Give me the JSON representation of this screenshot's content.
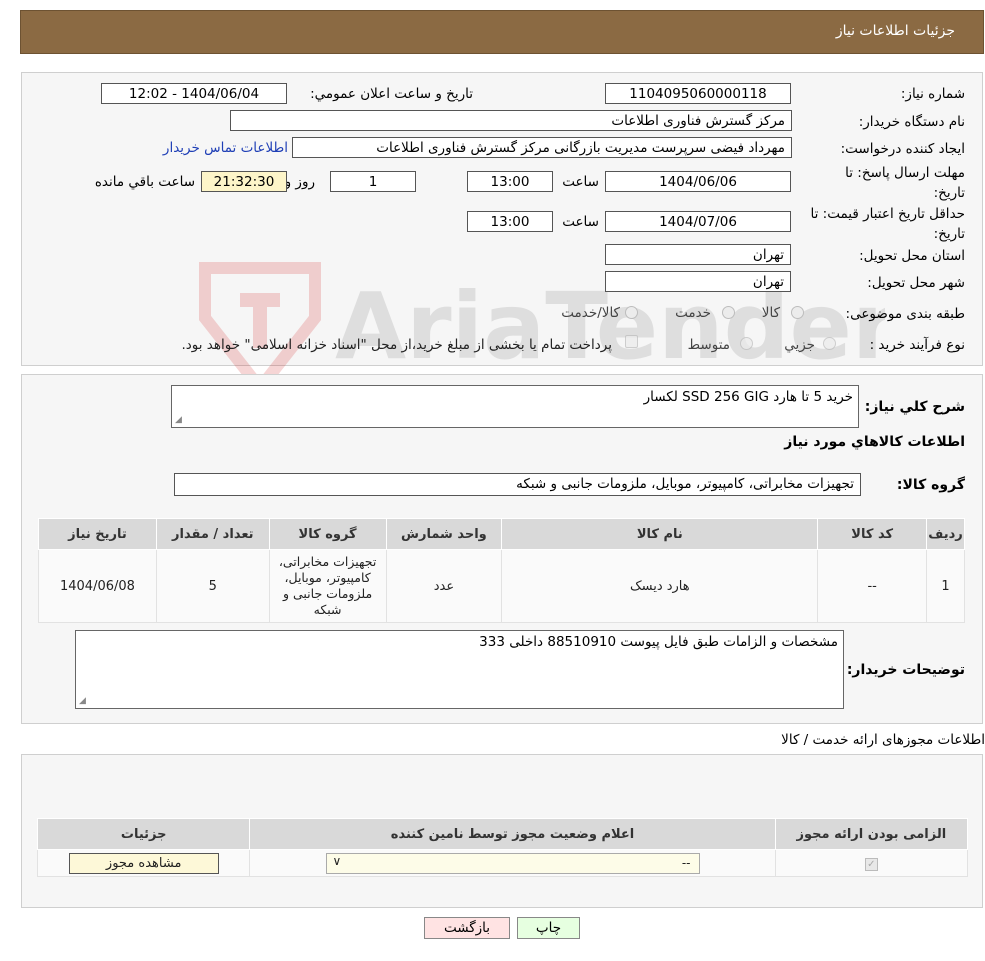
{
  "header": {
    "title": "جزئیات اطلاعات نیاز"
  },
  "watermark": {
    "text": "AriaTender.neT"
  },
  "fields": {
    "need_number_label": "شماره نیاز:",
    "need_number": "1104095060000118",
    "announce_label": "تاریخ و ساعت اعلان عمومي:",
    "announce_value": "1404/06/04 - 12:02",
    "buyer_org_label": "نام دستگاه خريدار:",
    "buyer_org": "مرکز گسترش فناوری اطلاعات",
    "creator_label": "ايجاد کننده درخواست:",
    "creator": "مهرداد فیضی سرپرست مدیریت بازرگانی مرکز گسترش فناوری اطلاعات",
    "contact_link": "اطلاعات تماس خريدار",
    "deadline_label": "مهلت ارسال پاسخ: تا تاريخ:",
    "deadline_date": "1404/06/06",
    "time_label": "ساعت",
    "deadline_time": "13:00",
    "days_value": "1",
    "days_label": "روز و",
    "remaining_time": "21:32:30",
    "remaining_label": "ساعت باقي مانده",
    "validity_label": "حداقل تاريخ اعتبار قيمت: تا تاريخ:",
    "validity_date": "1404/07/06",
    "validity_time": "13:00",
    "province_label": "استان محل تحويل:",
    "province": "تهران",
    "city_label": "شهر محل تحويل:",
    "city": "تهران",
    "category_label": "طبقه بندی موضوعی:",
    "category_options": [
      "کالا",
      "خدمت",
      "کالا/خدمت"
    ],
    "process_label": "نوع فرآيند خريد :",
    "process_options": [
      "جزيي",
      "متوسط"
    ],
    "process_note": "پرداخت تمام يا بخشی از مبلغ خريد،از محل \"اسناد خزانه اسلامی\" خواهد بود."
  },
  "summary": {
    "label": "شرح کلي نياز:",
    "text": "خرید 5 تا هارد SSD 256 GIG لکسار",
    "items_heading": "اطلاعات کالاهاي مورد نياز",
    "group_label": "گروه کالا:",
    "group_value": "تجهیزات مخابراتی، کامپیوتر، موبایل، ملزومات جانبی و شبکه"
  },
  "items_table": {
    "headers": [
      "رديف",
      "کد کالا",
      "نام کالا",
      "واحد شمارش",
      "گروه کالا",
      "تعداد / مقدار",
      "تاريخ نياز"
    ],
    "rows": [
      [
        "1",
        "--",
        "هارد دیسک",
        "عدد",
        "تجهیزات مخابراتی، کامپیوتر، موبایل، ملزومات جانبی و شبکه",
        "5",
        "1404/06/08"
      ]
    ]
  },
  "buyer_notes": {
    "label": "توضيحات خريدار:",
    "text": "مشخصات و الزامات طبق فایل پیوست 88510910 داخلی 333"
  },
  "permits": {
    "heading": "اطلاعات مجوزهای ارائه خدمت / کالا",
    "headers": [
      "الزامی بودن ارائه مجوز",
      "اعلام وضعيت مجوز توسط نامين کننده",
      "جزئيات"
    ],
    "select_value": "--",
    "view_button": "مشاهده مجوز"
  },
  "buttons": {
    "print": "چاپ",
    "back": "بازگشت"
  },
  "colors": {
    "header_bg": "#8b6a43",
    "print_bg": "#e6ffe0",
    "back_bg": "#ffe3e3",
    "link": "#1f3fb6"
  }
}
